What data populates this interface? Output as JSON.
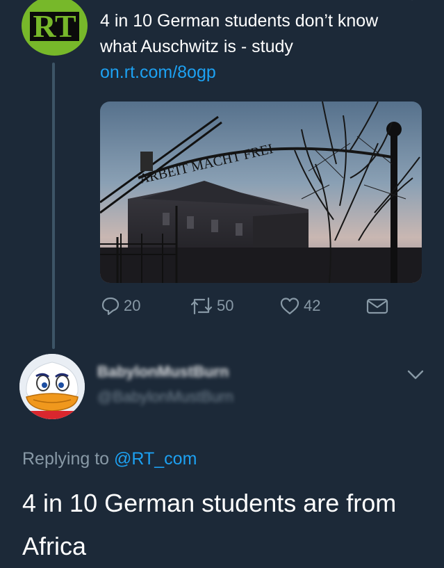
{
  "parent_tweet": {
    "author_logo_text": "RT",
    "text": "4 in 10 German students don’t know what Auschwitz is - study",
    "link": "on.rt.com/8ogp",
    "media_sign_text": "ARBEIT MACHT FREI",
    "actions": {
      "replies": "20",
      "retweets": "50",
      "likes": "42"
    }
  },
  "reply_tweet": {
    "author_name": "BabylonMustBurn",
    "author_handle": "@BabylonMustBurn",
    "replying_prefix": "Replying to",
    "replying_mention": "@RT_com",
    "text": "4 in 10 German students are from Africa"
  },
  "colors": {
    "background": "#1c2938",
    "accent": "#1da1f2",
    "muted": "#8899a6",
    "rt_green": "#77b82a"
  },
  "icons": [
    "reply-icon",
    "retweet-icon",
    "like-icon",
    "direct-message-icon",
    "chevron-down-icon"
  ]
}
